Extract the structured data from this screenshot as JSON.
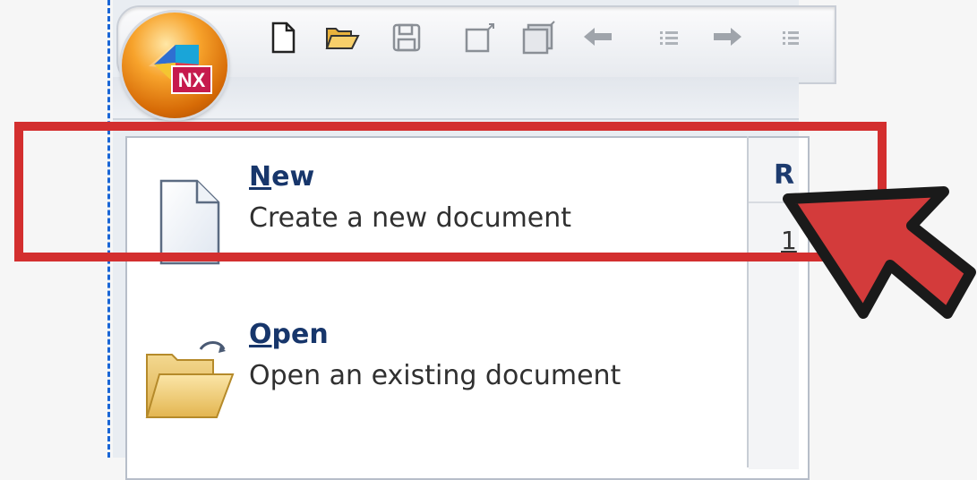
{
  "app": {
    "logo_text": "NX"
  },
  "quick_access": [
    {
      "name": "new-icon"
    },
    {
      "name": "open-folder-icon"
    },
    {
      "name": "save-icon"
    },
    {
      "name": "copy-window-icon"
    },
    {
      "name": "paste-window-icon"
    },
    {
      "name": "undo-icon"
    },
    {
      "name": "undo-dropdown-icon"
    },
    {
      "name": "redo-icon"
    },
    {
      "name": "redo-dropdown-icon"
    }
  ],
  "menu": {
    "new": {
      "mnemonic": "N",
      "title_rest": "ew",
      "description": "Create a new document"
    },
    "open": {
      "mnemonic": "O",
      "title_rest": "pen",
      "description": "Open an existing document"
    }
  },
  "recent": {
    "header": "R",
    "first_item": "1"
  },
  "colors": {
    "highlight": "#d32f2f",
    "pointer_fill": "#d33b3b",
    "pointer_outline": "#1a1a1a",
    "dash": "#1a66d6"
  }
}
